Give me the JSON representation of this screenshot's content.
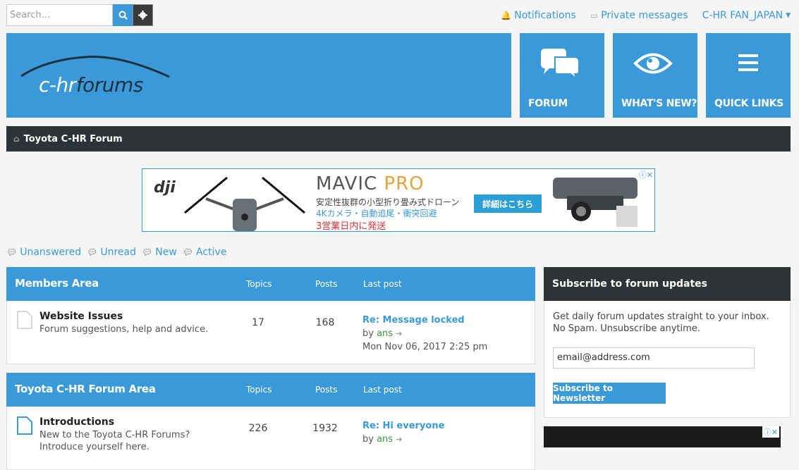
{
  "search": {
    "placeholder": "Search…"
  },
  "top_links": {
    "notifications": "Notifications",
    "private_messages": "Private messages",
    "user": "C-HR FAN_JAPAN"
  },
  "logo": {
    "part1": "c-hr",
    "part2": "forums"
  },
  "nav": [
    {
      "label": "FORUM",
      "icon": "speech-bubbles-icon"
    },
    {
      "label": "WHAT'S NEW?",
      "icon": "eye-icon"
    },
    {
      "label": "QUICK LINKS",
      "icon": "hamburger-menu-icon"
    }
  ],
  "breadcrumb": {
    "home": "Toyota C-HR Forum"
  },
  "ad": {
    "brand": "dji",
    "title_a": "MAVIC ",
    "title_b": "PRO",
    "line1": "安定性抜群の小型折り畳み式ドローン",
    "line2": "4Kカメラ・自動追尾・衝突回避",
    "line3": "3営業日内に発送",
    "cta": "詳細はこちら"
  },
  "quick_links": [
    "Unanswered",
    "Unread",
    "New",
    "Active"
  ],
  "forums": [
    {
      "category": "Members Area",
      "col_topics": "Topics",
      "col_posts": "Posts",
      "col_last": "Last post",
      "rows": [
        {
          "name": "Website Issues",
          "desc": "Forum suggestions, help and advice.",
          "topics": "17",
          "posts": "168",
          "last_title": "Re: Message locked",
          "last_by": "by ",
          "last_user": "ans",
          "last_date": "Mon Nov 06, 2017 2:25 pm"
        }
      ]
    },
    {
      "category": "Toyota C-HR Forum Area",
      "col_topics": "Topics",
      "col_posts": "Posts",
      "col_last": "Last post",
      "rows": [
        {
          "name": "Introductions",
          "desc": "New to the Toyota C-HR Forums?",
          "desc2": "Introduce yourself here.",
          "topics": "226",
          "posts": "1932",
          "last_title": "Re: Hi everyone",
          "last_by": "by ",
          "last_user": "ans",
          "last_date": ""
        }
      ]
    }
  ],
  "sidebar": {
    "title": "Subscribe to forum updates",
    "text": "Get daily forum updates straight to your inbox. No Spam. Unsubscribe anytime.",
    "email_value": "email@address.com",
    "button": "Subscribe to Newsletter"
  },
  "colors": {
    "accent": "#3a9ad9",
    "dark": "#2e3336",
    "user": "#3a9a3a"
  }
}
